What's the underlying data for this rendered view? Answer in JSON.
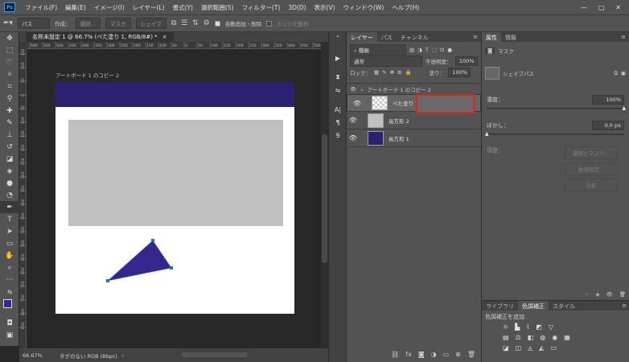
{
  "menubar": {
    "app_icon": "Ps",
    "items": [
      "ファイル(F)",
      "編集(E)",
      "イメージ(I)",
      "レイヤー(L)",
      "書式(Y)",
      "選択範囲(S)",
      "フィルター(T)",
      "3D(D)",
      "表示(V)",
      "ウィンドウ(W)",
      "ヘルプ(H)"
    ],
    "window_controls": [
      "—",
      "□",
      "✕"
    ]
  },
  "options": {
    "tool_mode": "パス",
    "make_label": "作成：",
    "select_btn": "選択…",
    "mask_btn": "マスク",
    "shape_btn": "シェイプ",
    "auto_add_delete": "自動追加・削除",
    "align_edges": "エッジを整列"
  },
  "document": {
    "tab_title": "名称未設定 1 @ 66.7% (べた塗り 1, RGB/8#) *",
    "tab_close": "×",
    "artboard_label": "アートボード 1 のコピー 2",
    "header_color": "#2b2171",
    "shape_color": "#33278d",
    "ruler_h_ticks": [
      "600",
      "550",
      "500",
      "450",
      "400",
      "350",
      "300",
      "250",
      "200",
      "150",
      "100",
      "50",
      "0",
      "50",
      "100",
      "150",
      "200",
      "250",
      "300",
      "350",
      "400",
      "450",
      "500"
    ],
    "ruler_v_ticks": [
      "150",
      "100",
      "50",
      "0",
      "50",
      "100",
      "150",
      "200",
      "250",
      "300",
      "350",
      "400",
      "450",
      "500",
      "550",
      "600",
      "650",
      "700",
      "750",
      "800",
      "850"
    ]
  },
  "status": {
    "zoom": "66.67%",
    "profile": "タグのない RGB (8bpc)"
  },
  "layers": {
    "tabs": [
      "レイヤー",
      "パス",
      "チャンネル"
    ],
    "filter_select": "種類",
    "blend_mode": "通常",
    "opacity_label": "不透明度：",
    "opacity_value": "100%",
    "lock_label": "ロック：",
    "fill_label": "塗り：",
    "fill_value": "100%",
    "artboard_group": "アートボード 1 のコピー 2",
    "items": [
      {
        "name": "べた塗り 1"
      },
      {
        "name": "長方形 2"
      },
      {
        "name": "長方形 1"
      }
    ]
  },
  "properties": {
    "tabs": [
      "属性",
      "情報"
    ],
    "mask_label": "マスク",
    "shape_path_label": "シェイプパス",
    "density_label": "濃度：",
    "density_value": "100%",
    "feather_label": "ぼかし：",
    "feather_value": "0.0 px",
    "refine_label": "調整：",
    "buttons": [
      "選択とマスク…",
      "色域指定…",
      "反転"
    ]
  },
  "adjustments": {
    "tabs": [
      "ライブラリ",
      "色調補正",
      "スタイル"
    ],
    "title": "色調補正を追加"
  }
}
